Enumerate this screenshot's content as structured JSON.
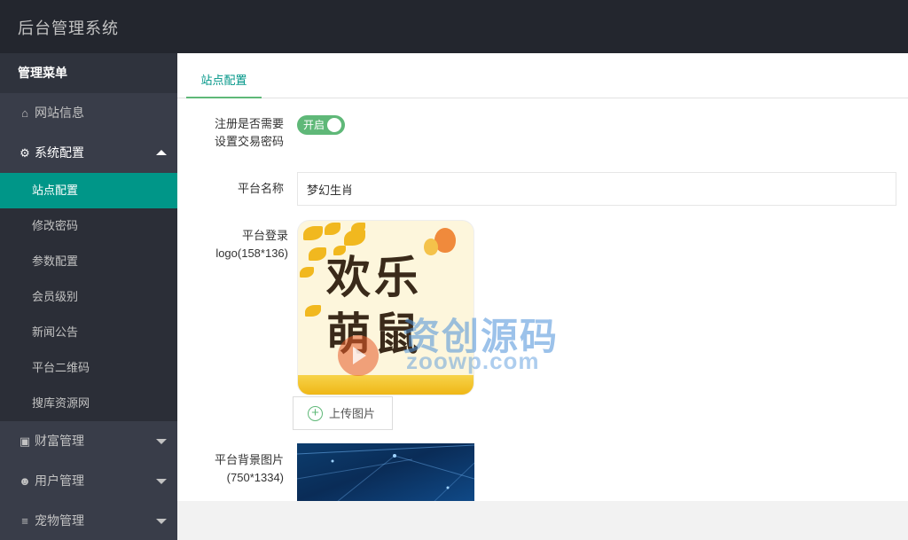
{
  "app": {
    "title": "后台管理系统"
  },
  "sidebar": {
    "header": "管理菜单",
    "site_info": {
      "label": "网站信息",
      "icon": "home-icon"
    },
    "system_config": {
      "label": "系统配置",
      "icon": "gears-icon",
      "children": [
        "站点配置",
        "修改密码",
        "参数配置",
        "会员级别",
        "新闻公告",
        "平台二维码",
        "搜库资源网"
      ],
      "active_child": "站点配置"
    },
    "wealth": {
      "label": "财富管理",
      "icon": "money-icon"
    },
    "users": {
      "label": "用户管理",
      "icon": "users-icon"
    },
    "pets": {
      "label": "宠物管理",
      "icon": "list-icon"
    }
  },
  "tabs": {
    "active": "站点配置"
  },
  "form": {
    "trade_pwd_label_line1": "注册是否需要",
    "trade_pwd_label_line2": "设置交易密码",
    "trade_pwd_switch": "开启",
    "platform_name_label": "平台名称",
    "platform_name_value": "梦幻生肖",
    "logo_label_line1": "平台登录",
    "logo_label_line2": "logo(158*136)",
    "logo_text_line1": "欢乐",
    "logo_text_line2": "萌鼠",
    "upload_button": "上传图片",
    "bg_label_line1": "平台背景图片",
    "bg_label_line2": "(750*1334)"
  },
  "watermark": {
    "cn": "资创源码",
    "url": "zoowp.com"
  },
  "colors": {
    "accent": "#009688",
    "switch": "#5fb878",
    "topbar": "#23262e",
    "sidebar": "#393d49"
  }
}
